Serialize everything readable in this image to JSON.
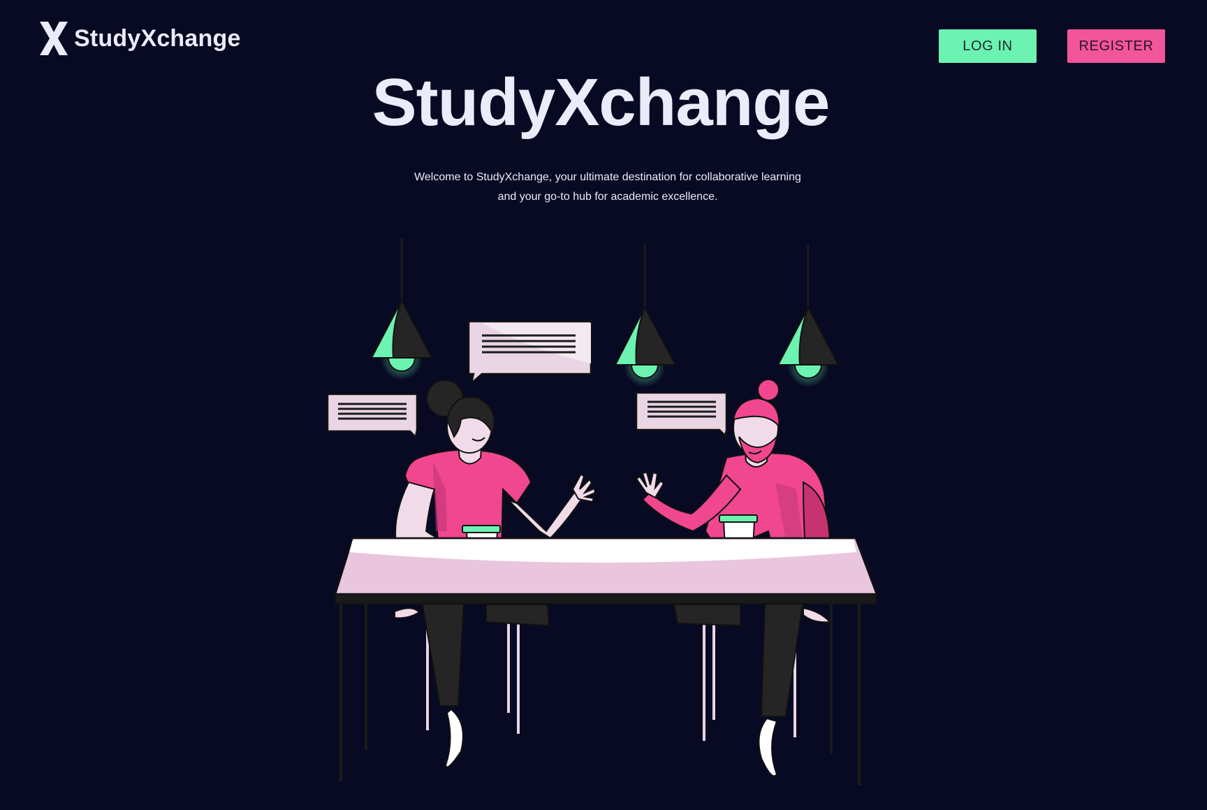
{
  "brand": {
    "name": "StudyXchange",
    "logo_icon": "x-logo-icon"
  },
  "nav": {
    "login_label": "LOG IN",
    "register_label": "REGISTER"
  },
  "hero": {
    "title": "StudyXchange",
    "subtitle_line1": "Welcome to StudyXchange, your ultimate destination for collaborative learning",
    "subtitle_line2": "and  your go-to hub for academic excellence."
  },
  "illustration": {
    "subject": "two students chatting at a table with coffee cups under pendant lamps",
    "icons": [
      "pendant-lamp-icon",
      "speech-bubble-icon",
      "coffee-cup-icon"
    ]
  },
  "colors": {
    "background": "#070a22",
    "text": "#ecebfa",
    "accent_green": "#6cf3b1",
    "accent_pink": "#f2559a",
    "table": "#e9c6dd"
  }
}
